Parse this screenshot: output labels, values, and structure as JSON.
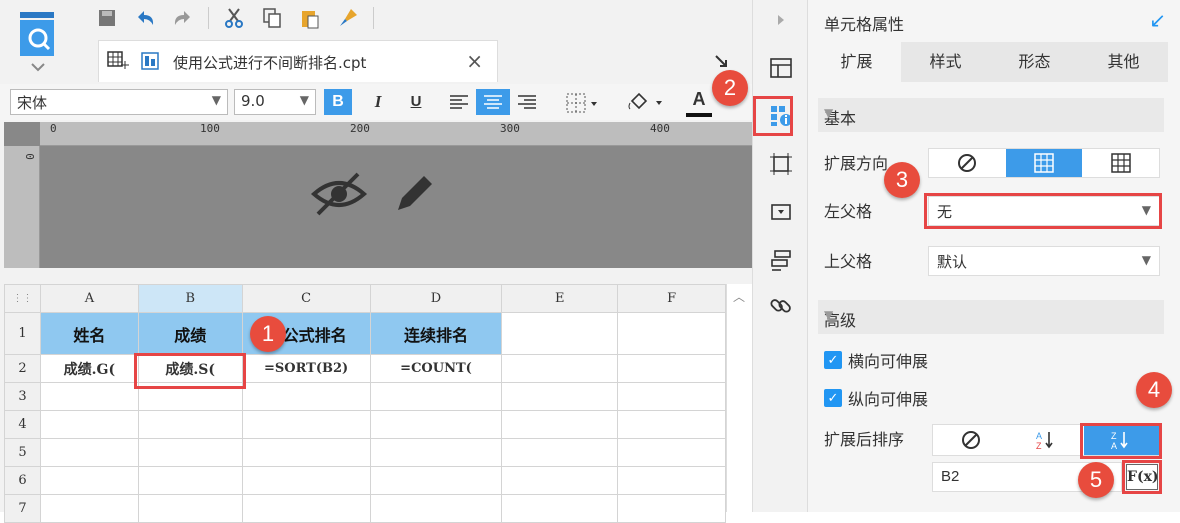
{
  "tab": {
    "filename": "使用公式进行不间断排名.cpt"
  },
  "format": {
    "font": "宋体",
    "size": "9.0",
    "bold": "B",
    "italic": "I",
    "underline": "U",
    "fontcolor": "A"
  },
  "ruler": {
    "ticks": [
      "0",
      "100",
      "200",
      "300",
      "400"
    ],
    "vtick": "0"
  },
  "sheet": {
    "columns": [
      "A",
      "B",
      "C",
      "D",
      "E",
      "F"
    ],
    "rows": [
      "1",
      "2",
      "3",
      "4",
      "5",
      "6",
      "7"
    ],
    "cells": {
      "A1": "姓名",
      "B1": "成绩",
      "C1": "公式排名",
      "D1": "连续排名",
      "A2": "成绩.G(",
      "B2": "成绩.S(",
      "C2": "=SORT(B2)",
      "D2": "=COUNT("
    }
  },
  "panel": {
    "title": "单元格属性",
    "tabs": [
      "扩展",
      "样式",
      "形态",
      "其他"
    ],
    "basic": "基本",
    "expand_direction": "扩展方向",
    "left_parent": "左父格",
    "left_parent_value": "无",
    "top_parent": "上父格",
    "top_parent_value": "默认",
    "advanced": "高级",
    "h_expand": "横向可伸展",
    "v_expand": "纵向可伸展",
    "sort_after_expand": "扩展后排序",
    "sort_formula": "B2",
    "fx": "F(x)"
  },
  "badges": [
    "1",
    "2",
    "3",
    "4",
    "5"
  ],
  "colors": {
    "accent": "#3d9be9",
    "header_cell": "#8fc8f0",
    "highlight": "#e64545",
    "badge": "#e84c3d"
  }
}
